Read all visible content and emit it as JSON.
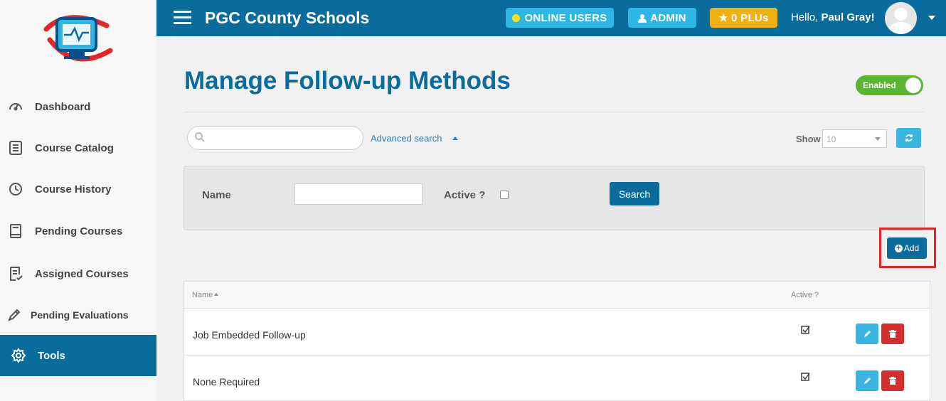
{
  "header": {
    "app_title": "PGC County Schools",
    "online_users_label": "ONLINE USERS",
    "admin_label": "ADMIN",
    "plu_label": "0 PLUs",
    "hello_prefix": "Hello, ",
    "user_name": "Paul Gray!"
  },
  "sidebar": {
    "items": [
      {
        "label": "Dashboard",
        "icon": "gauge-icon"
      },
      {
        "label": "Course Catalog",
        "icon": "catalog-icon"
      },
      {
        "label": "Course History",
        "icon": "history-icon"
      },
      {
        "label": "Pending Courses",
        "icon": "book-icon"
      },
      {
        "label": "Assigned Courses",
        "icon": "checklist-icon"
      },
      {
        "label": "Pending Evaluations",
        "icon": "pencil-icon"
      },
      {
        "label": "Tools",
        "icon": "gear-icon",
        "active": true
      }
    ]
  },
  "main": {
    "page_title": "Manage Follow-up Methods",
    "toggle_label": "Enabled",
    "search_placeholder": "",
    "advanced_search_label": "Advanced search",
    "show_label": "Show",
    "show_value": "10",
    "filter": {
      "name_label": "Name",
      "name_value": "",
      "active_label": "Active ?",
      "active_checked": false,
      "search_button": "Search"
    },
    "add_button": "Add",
    "table": {
      "columns": [
        "Name",
        "Active ?"
      ],
      "rows": [
        {
          "name": "Job Embedded Follow-up",
          "active": true
        },
        {
          "name": "None Required",
          "active": true
        }
      ]
    }
  },
  "colors": {
    "primary": "#0a6c9d",
    "info": "#39b5e1",
    "warning": "#f0b115",
    "danger": "#d42e2e",
    "success": "#5ab62e",
    "highlight": "#e32626"
  }
}
